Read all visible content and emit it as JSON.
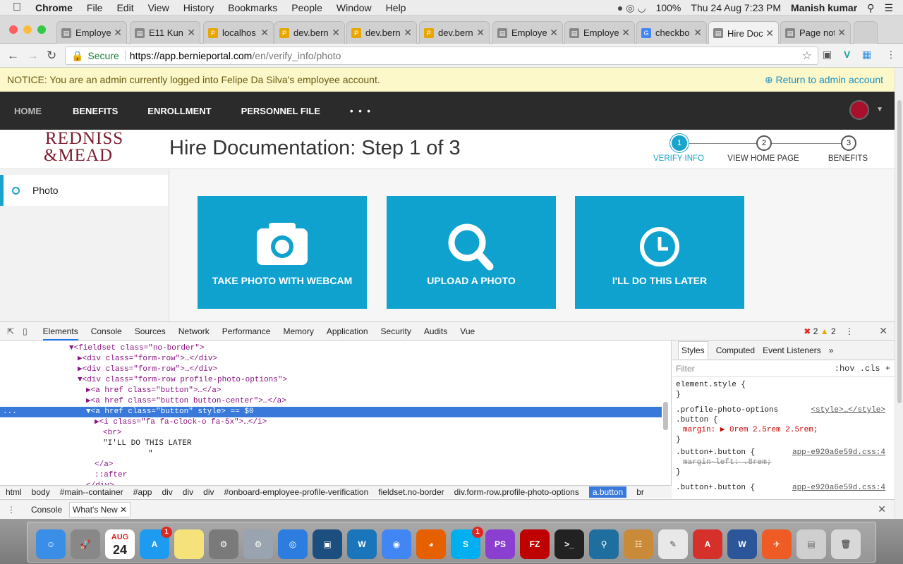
{
  "menubar": {
    "apple": "",
    "app": "Chrome",
    "items": [
      "File",
      "Edit",
      "View",
      "History",
      "Bookmarks",
      "People",
      "Window",
      "Help"
    ],
    "battery": "100%",
    "datetime": "Thu 24 Aug  7:23 PM",
    "user": "Manish kumar"
  },
  "tabs": [
    {
      "title": "Employe",
      "favicon": "doc"
    },
    {
      "title": "E11 Kun",
      "favicon": "doc"
    },
    {
      "title": "localhos",
      "favicon": "pma"
    },
    {
      "title": "dev.bern",
      "favicon": "pma"
    },
    {
      "title": "dev.bern",
      "favicon": "pma"
    },
    {
      "title": "dev.bern",
      "favicon": "pma"
    },
    {
      "title": "Employe",
      "favicon": "doc"
    },
    {
      "title": "Employe",
      "favicon": "doc"
    },
    {
      "title": "checkbo",
      "favicon": "google"
    },
    {
      "title": "Hire Doc",
      "favicon": "doc"
    },
    {
      "title": "Page not",
      "favicon": "doc"
    }
  ],
  "address": {
    "secure": "Secure",
    "host": "https://app.bernieportal.com",
    "path": "/en/verify_info/photo"
  },
  "notice": {
    "message": "NOTICE: You are an admin currently logged into Felipe Da Silva's employee account.",
    "return_link": "Return to admin account"
  },
  "nav": {
    "items": [
      "HOME",
      "BENEFITS",
      "ENROLLMENT",
      "PERSONNEL FILE"
    ],
    "more": "• • •"
  },
  "header": {
    "logo_line1": "REDNISS",
    "logo_line2": "&MEAD",
    "title": "Hire Documentation: Step 1 of 3"
  },
  "steps": [
    {
      "num": "1",
      "label": "VERIFY INFO"
    },
    {
      "num": "2",
      "label": "VIEW HOME PAGE"
    },
    {
      "num": "3",
      "label": "BENEFITS"
    }
  ],
  "sidebar": {
    "items": [
      {
        "label": "Photo"
      }
    ]
  },
  "options": [
    {
      "label": "TAKE PHOTO WITH WEBCAM",
      "icon": "camera-icon"
    },
    {
      "label": "UPLOAD A PHOTO",
      "icon": "search-icon"
    },
    {
      "label": "I'LL DO THIS LATER",
      "icon": "clock-icon"
    }
  ],
  "devtools": {
    "tabs": [
      "Elements",
      "Console",
      "Sources",
      "Network",
      "Performance",
      "Memory",
      "Application",
      "Security",
      "Audits",
      "Vue"
    ],
    "errors": "2",
    "warnings": "2",
    "dom": [
      "▼<fieldset class=\"no-border\">",
      "▶<div class=\"form-row\">…</div>",
      "▶<div class=\"form-row\">…</div>",
      "▼<div class=\"form-row profile-photo-options\">",
      "▶<a href class=\"button\">…</a>",
      "▶<a href class=\"button button-center\">…</a>",
      "▼<a href class=\"button\" style> == $0",
      "▶<i class=\"fa fa-clock-o fa-5x\">…</i>",
      "<br>",
      "\"I'LL DO THIS LATER",
      "\"",
      "</a>",
      "::after",
      "</div>"
    ],
    "breadcrumbs": [
      "html",
      "body",
      "#main--container",
      "#app",
      "div",
      "div",
      "div",
      "#onboard-employee-profile-verification",
      "fieldset.no-border",
      "div.form-row.profile-photo-options",
      "a.button",
      "br"
    ],
    "style_tabs": [
      "Styles",
      "Computed",
      "Event Listeners",
      "»"
    ],
    "filter": "Filter",
    "filter_opts": ":hov  .cls  +",
    "rules": [
      {
        "sel": "element.style {",
        "src": ""
      },
      {
        "sel": "}",
        "src": ""
      },
      {
        "sel": ".profile-photo-options",
        "src": "<style>…</style>"
      },
      {
        "sel": ".button {",
        "src": ""
      },
      {
        "sel": "margin: ▶ 0rem 2.5rem 2.5rem;",
        "src": ""
      },
      {
        "sel": "}",
        "src": ""
      },
      {
        "sel": ".button+.button {",
        "src": "app-e920a6e59d.css:4"
      },
      {
        "sel": "margin-left: .8rem;",
        "src": ""
      },
      {
        "sel": "}",
        "src": ""
      },
      {
        "sel": ".button+.button {",
        "src": "app-e920a6e59d.css:4"
      }
    ],
    "drawer_tabs": [
      "Console",
      "What's New"
    ]
  },
  "dock": [
    "Finder",
    "Launchpad",
    "Calendar",
    "App Store",
    "Notes",
    "Utility",
    "System Preferences",
    "Safari",
    "Sourcetree",
    "Wunderlist",
    "Chrome",
    "Firefox",
    "Skype",
    "PhpStorm",
    "FileZilla",
    "Terminal",
    "Sourcetree2",
    "Sequel",
    "Notes2",
    "Acrobat",
    "Word",
    "Postman",
    "Docs",
    "Trash"
  ],
  "dock_badges": {
    "appstore": "1",
    "skype": "1"
  },
  "calendar_day": "24",
  "calendar_month": "AUG"
}
